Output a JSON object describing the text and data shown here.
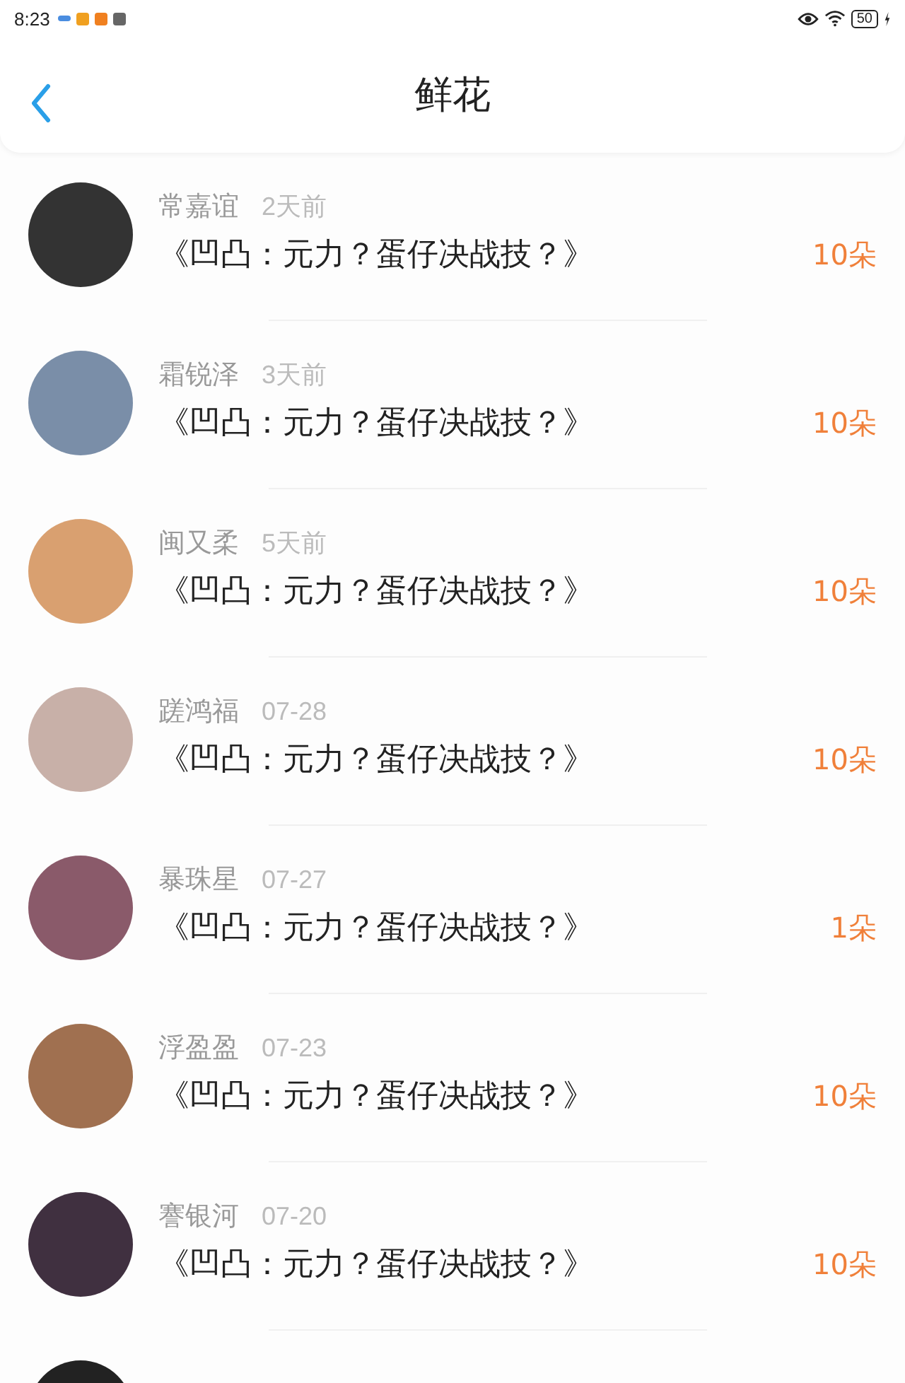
{
  "status_bar": {
    "time": "8:23",
    "battery": "50"
  },
  "header": {
    "title": "鲜花"
  },
  "items": [
    {
      "name": "常嘉谊",
      "time": "2天前",
      "title": "《凹凸：元力？蛋仔决战技？》",
      "count": "10朵"
    },
    {
      "name": "霜锐泽",
      "time": "3天前",
      "title": "《凹凸：元力？蛋仔决战技？》",
      "count": "10朵"
    },
    {
      "name": "闽又柔",
      "time": "5天前",
      "title": "《凹凸：元力？蛋仔决战技？》",
      "count": "10朵"
    },
    {
      "name": "蹉鸿福",
      "time": "07-28",
      "title": "《凹凸：元力？蛋仔决战技？》",
      "count": "10朵"
    },
    {
      "name": "暴珠星",
      "time": "07-27",
      "title": "《凹凸：元力？蛋仔决战技？》",
      "count": "1朵"
    },
    {
      "name": "浮盈盈",
      "time": "07-23",
      "title": "《凹凸：元力？蛋仔决战技？》",
      "count": "10朵"
    },
    {
      "name": "謇银河",
      "time": "07-20",
      "title": "《凹凸：元力？蛋仔决战技？》",
      "count": "10朵"
    }
  ]
}
